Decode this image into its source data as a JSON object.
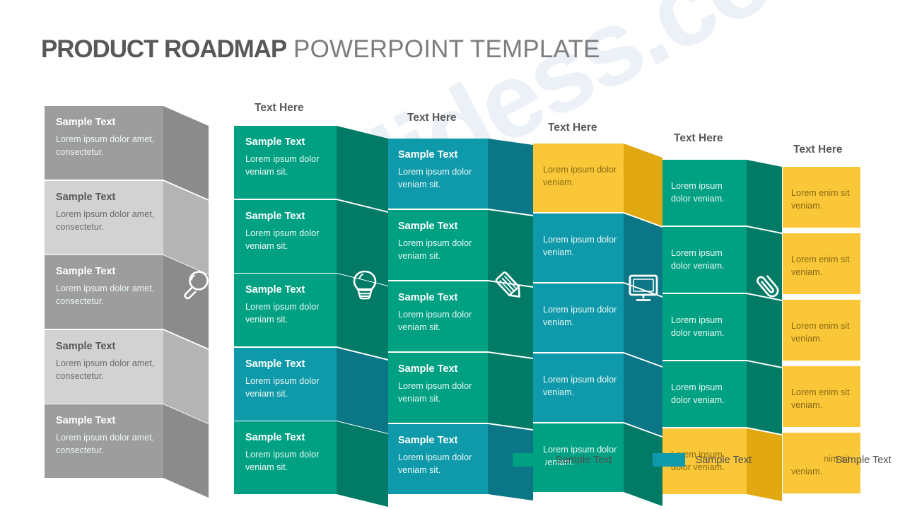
{
  "title": {
    "strong": "PRODUCT ROADMAP",
    "light": " POWERPOINT TEMPLATE"
  },
  "watermark": "slidess.com",
  "colors": {
    "gray_dark": "#9d9d9d",
    "gray_light": "#d2d2d2",
    "gray_bevel_dark": "#8b8b8b",
    "gray_bevel_light": "#b4b4b4",
    "green": "#00a183",
    "green_bevel": "#017a66",
    "blue": "#0f9aab",
    "blue_bevel": "#0b7686",
    "yellow": "#f9c738",
    "yellow_bevel": "#e1a811",
    "white": "#ffffff"
  },
  "headers": [
    {
      "label": "Text Here"
    },
    {
      "label": "Text Here"
    },
    {
      "label": "Text Here"
    },
    {
      "label": "Text Here"
    },
    {
      "label": "Text Here"
    }
  ],
  "columns": [
    {
      "name": "column-1",
      "icon": "magnifier-icon",
      "rows": [
        {
          "head": "Sample Text",
          "body": "Lorem ipsum dolor amet, consectetur.",
          "tone": "gray-dark"
        },
        {
          "head": "Sample Text",
          "body": "Lorem ipsum dolor amet, consectetur.",
          "tone": "gray-light"
        },
        {
          "head": "Sample Text",
          "body": "Lorem ipsum dolor amet, consectetur.",
          "tone": "gray-dark"
        },
        {
          "head": "Sample Text",
          "body": "Lorem ipsum dolor amet, consectetur.",
          "tone": "gray-light"
        },
        {
          "head": "Sample Text",
          "body": "Lorem ipsum dolor amet, consectetur.",
          "tone": "gray-dark"
        }
      ]
    },
    {
      "name": "column-2",
      "icon": "lightbulb-icon",
      "rows": [
        {
          "head": "Sample Text",
          "body": "Lorem ipsum dolor veniam sit.",
          "tone": "green"
        },
        {
          "head": "Sample Text",
          "body": "Lorem ipsum dolor veniam sit.",
          "tone": "green"
        },
        {
          "head": "Sample Text",
          "body": "Lorem ipsum dolor veniam sit.",
          "tone": "green"
        },
        {
          "head": "Sample Text",
          "body": "Lorem ipsum dolor veniam sit.",
          "tone": "blue"
        },
        {
          "head": "Sample Text",
          "body": "Lorem ipsum dolor veniam sit.",
          "tone": "green"
        }
      ]
    },
    {
      "name": "column-3",
      "icon": "pencil-icon",
      "rows": [
        {
          "head": "Sample Text",
          "body": "Lorem ipsum dolor veniam sit.",
          "tone": "blue"
        },
        {
          "head": "Sample Text",
          "body": "Lorem ipsum dolor veniam sit.",
          "tone": "green"
        },
        {
          "head": "Sample Text",
          "body": "Lorem ipsum dolor veniam sit.",
          "tone": "green"
        },
        {
          "head": "Sample Text",
          "body": "Lorem ipsum dolor veniam sit.",
          "tone": "green"
        },
        {
          "head": "Sample Text",
          "body": "Lorem ipsum dolor veniam sit.",
          "tone": "blue"
        }
      ]
    },
    {
      "name": "column-4",
      "icon": "monitor-icon",
      "rows": [
        {
          "head": "",
          "body": "Lorem ipsum dolor veniam.",
          "tone": "yellow"
        },
        {
          "head": "",
          "body": "Lorem ipsum dolor veniam.",
          "tone": "blue"
        },
        {
          "head": "",
          "body": "Lorem ipsum dolor veniam.",
          "tone": "blue"
        },
        {
          "head": "",
          "body": "Lorem ipsum dolor veniam.",
          "tone": "blue"
        },
        {
          "head": "",
          "body": "Lorem ipsum dolor veniam.",
          "tone": "green"
        }
      ]
    },
    {
      "name": "column-5",
      "icon": "paperclip-icon",
      "rows": [
        {
          "head": "",
          "body": "Lorem ipsum dolor veniam.",
          "tone": "green"
        },
        {
          "head": "",
          "body": "Lorem ipsum dolor veniam.",
          "tone": "green"
        },
        {
          "head": "",
          "body": "Lorem ipsum dolor veniam.",
          "tone": "green"
        },
        {
          "head": "",
          "body": "Lorem ipsum dolor veniam.",
          "tone": "green"
        },
        {
          "head": "",
          "body": "Lorem ipsum dolor veniam.",
          "tone": "yellow"
        }
      ]
    },
    {
      "name": "column-6",
      "icon": "",
      "rows": [
        {
          "head": "",
          "body": "Lorem enim sit veniam.",
          "tone": "yellow"
        },
        {
          "head": "",
          "body": "Lorem enim sit veniam.",
          "tone": "yellow"
        },
        {
          "head": "",
          "body": "Lorem enim sit veniam.",
          "tone": "yellow"
        },
        {
          "head": "",
          "body": "Lorem enim sit veniam.",
          "tone": "yellow"
        },
        {
          "head": "",
          "body": "Lorem enim sit veniam.",
          "tone": "yellow"
        }
      ]
    }
  ],
  "legend": [
    {
      "label": "Sample Text",
      "color": "#00a183"
    },
    {
      "label": "Sample Text",
      "color": "#0f9aab"
    },
    {
      "label": "Sample Text",
      "color": "#f9c738"
    }
  ]
}
